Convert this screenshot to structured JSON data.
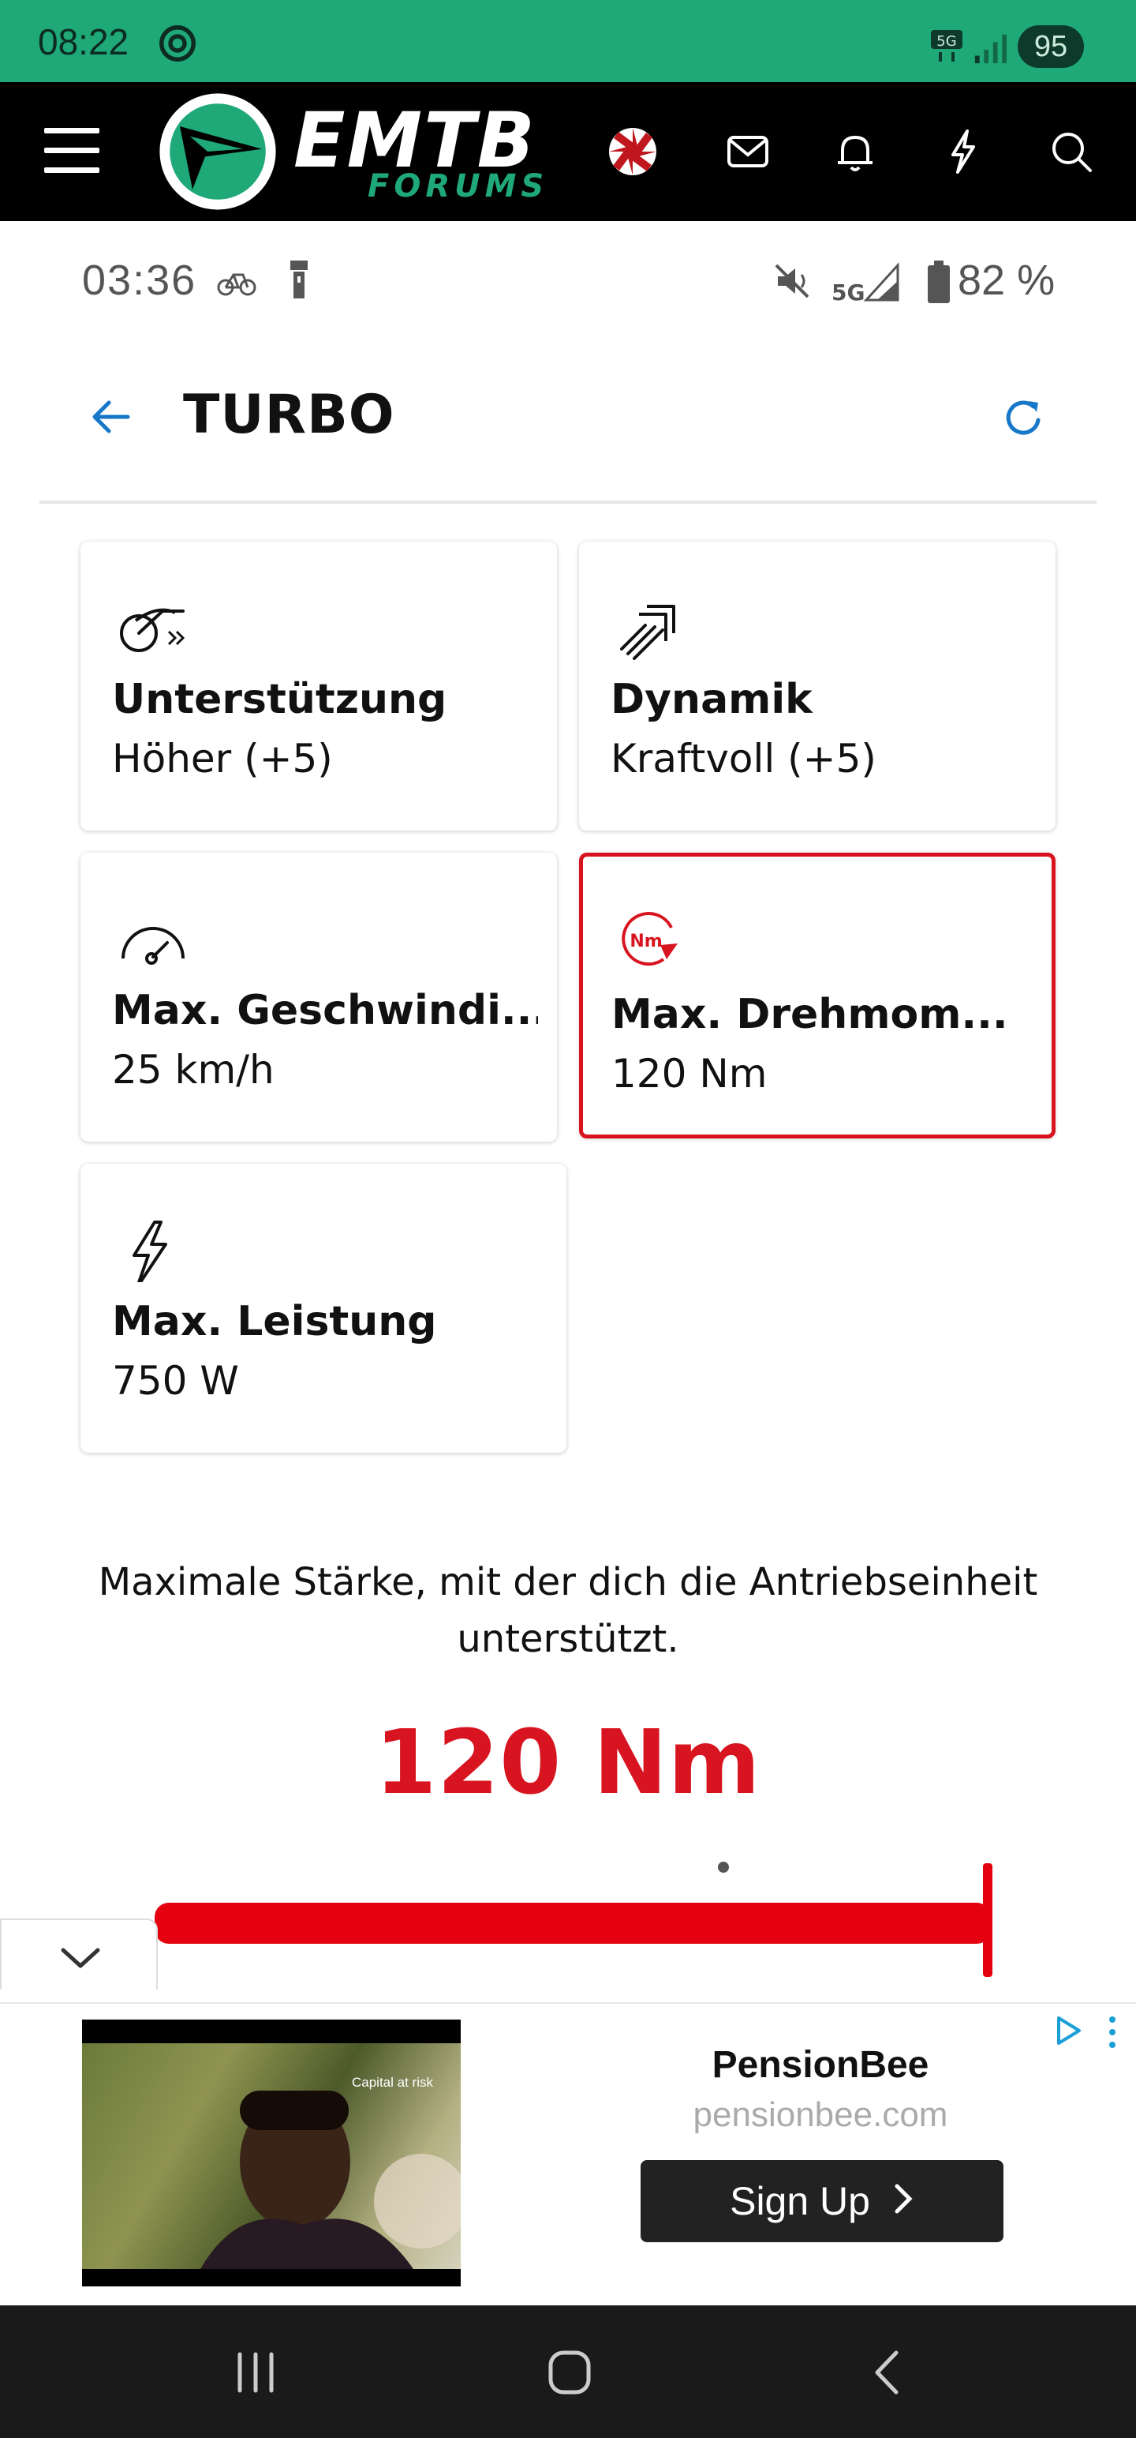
{
  "status_bar": {
    "time": "08:22",
    "network": "5G",
    "battery": "95",
    "bg_color": "#1fa878"
  },
  "forum_header": {
    "logo_title": "EMTB",
    "logo_subtitle": "FORUMS",
    "icons": [
      "menu-icon",
      "umbrella-avatar-icon",
      "inbox-icon",
      "bell-icon",
      "bolt-icon",
      "search-icon"
    ]
  },
  "app_status": {
    "time": "03:36",
    "battery_percent": "82 %",
    "network": "5G"
  },
  "page": {
    "title": "TURBO",
    "accent_color": "#d7141f",
    "link_color": "#1677c8"
  },
  "cards": [
    {
      "icon": "assist-gauge-icon",
      "title": "Unterstützung",
      "value": "Höher (+5)",
      "active": false
    },
    {
      "icon": "dynamics-icon",
      "title": "Dynamik",
      "value": "Kraftvoll (+5)",
      "active": false
    },
    {
      "icon": "speedometer-icon",
      "title": "Max. Geschwindi...",
      "value": "25 km/h",
      "active": false
    },
    {
      "icon": "torque-nm-icon",
      "title": "Max. Drehmom...",
      "value": "120 Nm",
      "active": true
    },
    {
      "icon": "lightning-icon",
      "title": "Max. Leistung",
      "value": "750 W",
      "active": false
    }
  ],
  "detail": {
    "description": "Maximale Stärke, mit der dich die Antriebseinheit unterstützt.",
    "value": "120 Nm",
    "slider_fraction": 1.0
  },
  "ad": {
    "brand": "PensionBee",
    "domain": "pensionbee.com",
    "cta": "Sign Up",
    "video_caption": "Capital at risk"
  }
}
